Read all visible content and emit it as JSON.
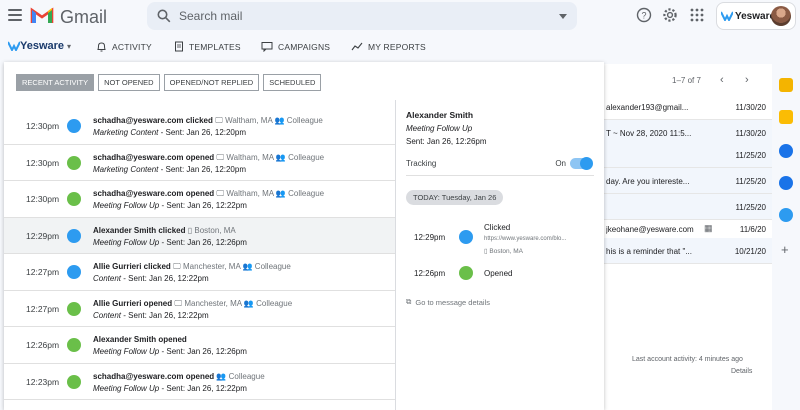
{
  "gmail": {
    "title": "Gmail",
    "search_placeholder": "Search mail",
    "account_brand": "Yesware"
  },
  "toolbar": {
    "brand": "Yesware",
    "nav": [
      {
        "label": "ACTIVITY",
        "icon": "bell-icon"
      },
      {
        "label": "TEMPLATES",
        "icon": "document-icon"
      },
      {
        "label": "CAMPAIGNS",
        "icon": "chat-icon"
      },
      {
        "label": "MY REPORTS",
        "icon": "chart-line-icon"
      }
    ]
  },
  "filters": [
    "RECENT ACTIVITY",
    "NOT OPENED",
    "OPENED/NOT REPLIED",
    "SCHEDULED"
  ],
  "activity": [
    {
      "time": "12:30pm",
      "type": "click",
      "who": "schadha@yesware.com clicked",
      "meta": "Waltham, MA",
      "tag": "Colleague",
      "subject": "Marketing Content",
      "sent": "- Sent: Jan 26, 12:20pm",
      "device": "desktop"
    },
    {
      "time": "12:30pm",
      "type": "open",
      "who": "schadha@yesware.com opened",
      "meta": "Waltham, MA",
      "tag": "Colleague",
      "subject": "Marketing Content",
      "sent": "- Sent: Jan 26, 12:20pm",
      "device": "desktop"
    },
    {
      "time": "12:30pm",
      "type": "open",
      "who": "schadha@yesware.com opened",
      "meta": "Waltham, MA",
      "tag": "Colleague",
      "subject": "Meeting Follow Up",
      "sent": "- Sent: Jan 26, 12:22pm",
      "device": "desktop"
    },
    {
      "time": "12:29pm",
      "type": "click",
      "who": "Alexander Smith clicked",
      "meta": "Boston, MA",
      "tag": "",
      "subject": "Meeting Follow Up",
      "sent": "- Sent: Jan 26, 12:26pm",
      "device": "mobile"
    },
    {
      "time": "12:27pm",
      "type": "click",
      "who": "Allie Gurrieri clicked",
      "meta": "Manchester, MA",
      "tag": "Colleague",
      "subject": "Content",
      "sent": "- Sent: Jan 26, 12:22pm",
      "device": "desktop"
    },
    {
      "time": "12:27pm",
      "type": "open",
      "who": "Allie Gurrieri opened",
      "meta": "Manchester, MA",
      "tag": "Colleague",
      "subject": "Content",
      "sent": "- Sent: Jan 26, 12:22pm",
      "device": "desktop"
    },
    {
      "time": "12:26pm",
      "type": "open",
      "who": "Alexander Smith opened",
      "meta": "",
      "tag": "",
      "subject": "Meeting Follow Up",
      "sent": "- Sent: Jan 26, 12:26pm",
      "device": ""
    },
    {
      "time": "12:23pm",
      "type": "open",
      "who": "schadha@yesware.com opened",
      "meta": "",
      "tag": "Colleague",
      "subject": "Meeting Follow Up",
      "sent": "- Sent: Jan 26, 12:22pm",
      "device": "desktop"
    }
  ],
  "detail": {
    "name": "Alexander Smith",
    "subject": "Meeting Follow Up",
    "sent": "Sent: Jan 26, 12:26pm",
    "tracking_label": "Tracking",
    "tracking_state": "On",
    "tracking_on": true,
    "today": "TODAY: Tuesday, Jan 26",
    "events": [
      {
        "time": "12:29pm",
        "type": "click",
        "title": "Clicked",
        "url": "https://www.yesware.com/blo...",
        "location": "Boston, MA"
      },
      {
        "time": "12:26pm",
        "type": "open",
        "title": "Opened",
        "url": "",
        "location": ""
      }
    ],
    "goto": "Go to message details"
  },
  "inbox": {
    "pager": "1–7 of 7",
    "rows": [
      {
        "snippet": "alexander193@gmail...",
        "date": "11/30/20",
        "read": false
      },
      {
        "snippet": "T ~ Nov 28, 2020 11:5...",
        "date": "11/30/20",
        "read": true
      },
      {
        "snippet": "",
        "date": "11/25/20",
        "read": true
      },
      {
        "snippet": "day. Are you intereste...",
        "date": "11/25/20",
        "read": true
      },
      {
        "snippet": "",
        "date": "11/25/20",
        "read": true
      },
      {
        "snippet": "jkeohane@yesware.com",
        "date": "11/6/20",
        "read": false
      },
      {
        "snippet": "his is a reminder that \"...",
        "date": "10/21/20",
        "read": true
      }
    ],
    "last_activity": "Last account activity: 4 minutes ago",
    "details": "Details"
  },
  "colors": {
    "click": "#2d9bf0",
    "open": "#6abf49",
    "brand": "#1a3a6b"
  }
}
